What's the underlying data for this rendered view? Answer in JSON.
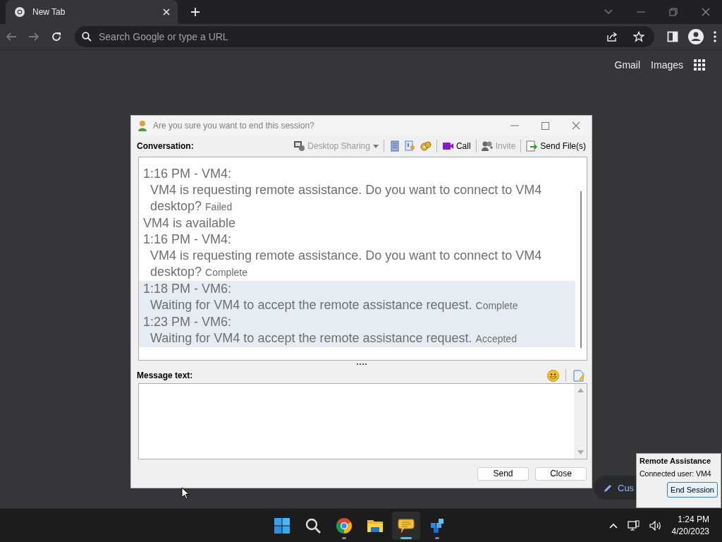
{
  "browser": {
    "tab": {
      "title": "New Tab",
      "selected": true
    },
    "address": {
      "placeholder": "Search Google or type a URL"
    },
    "links": [
      "Gmail",
      "Images"
    ],
    "customize_button": "Cus"
  },
  "dialog": {
    "title": "Are you sure you want to end this session?",
    "conversation_label": "Conversation:",
    "toolbar": [
      {
        "label": "Desktop Sharing",
        "disabled": true
      },
      {
        "label": "Call",
        "disabled": false
      },
      {
        "label": "Invite",
        "disabled": true
      },
      {
        "label": "Send File(s)",
        "disabled": false
      }
    ],
    "messages": [
      {
        "kind": "message",
        "header": "1:16 PM - VM4:",
        "text": "VM4 is requesting remote assistance. Do you want to connect to VM4 desktop?",
        "status": "Failed",
        "highlighted": false
      },
      {
        "kind": "notice",
        "text": "VM4 is available",
        "highlighted": false
      },
      {
        "kind": "message",
        "header": "1:16 PM - VM4:",
        "text": "VM4 is requesting remote assistance. Do you want to connect to VM4 desktop?",
        "status": "Complete",
        "highlighted": false
      },
      {
        "kind": "message",
        "header": "1:18 PM - VM6:",
        "text": "Waiting for VM4 to accept the remote assistance request.",
        "status": "Complete",
        "highlighted": true
      },
      {
        "kind": "message",
        "header": "1:23 PM - VM6:",
        "text": "Waiting for VM4 to accept the remote assistance request.",
        "status": "Accepted",
        "highlighted": true
      }
    ],
    "message_label": "Message text:",
    "buttons": [
      "Send",
      "Close"
    ]
  },
  "popup": {
    "title": "Remote Assistance",
    "label": "Connected user:",
    "value": "VM4",
    "button": "End Session"
  },
  "taskbar": {
    "apps": [
      {
        "kind": "start",
        "selected": false,
        "running": false
      },
      {
        "kind": "search",
        "selected": false,
        "running": false
      },
      {
        "kind": "browser",
        "selected": false,
        "running": true
      },
      {
        "kind": "files",
        "selected": false,
        "running": false
      },
      {
        "kind": "chat",
        "selected": true,
        "running": true
      },
      {
        "kind": "cube",
        "selected": false,
        "running": true
      }
    ],
    "time": "1:24 PM",
    "date": "4/20/2023"
  }
}
